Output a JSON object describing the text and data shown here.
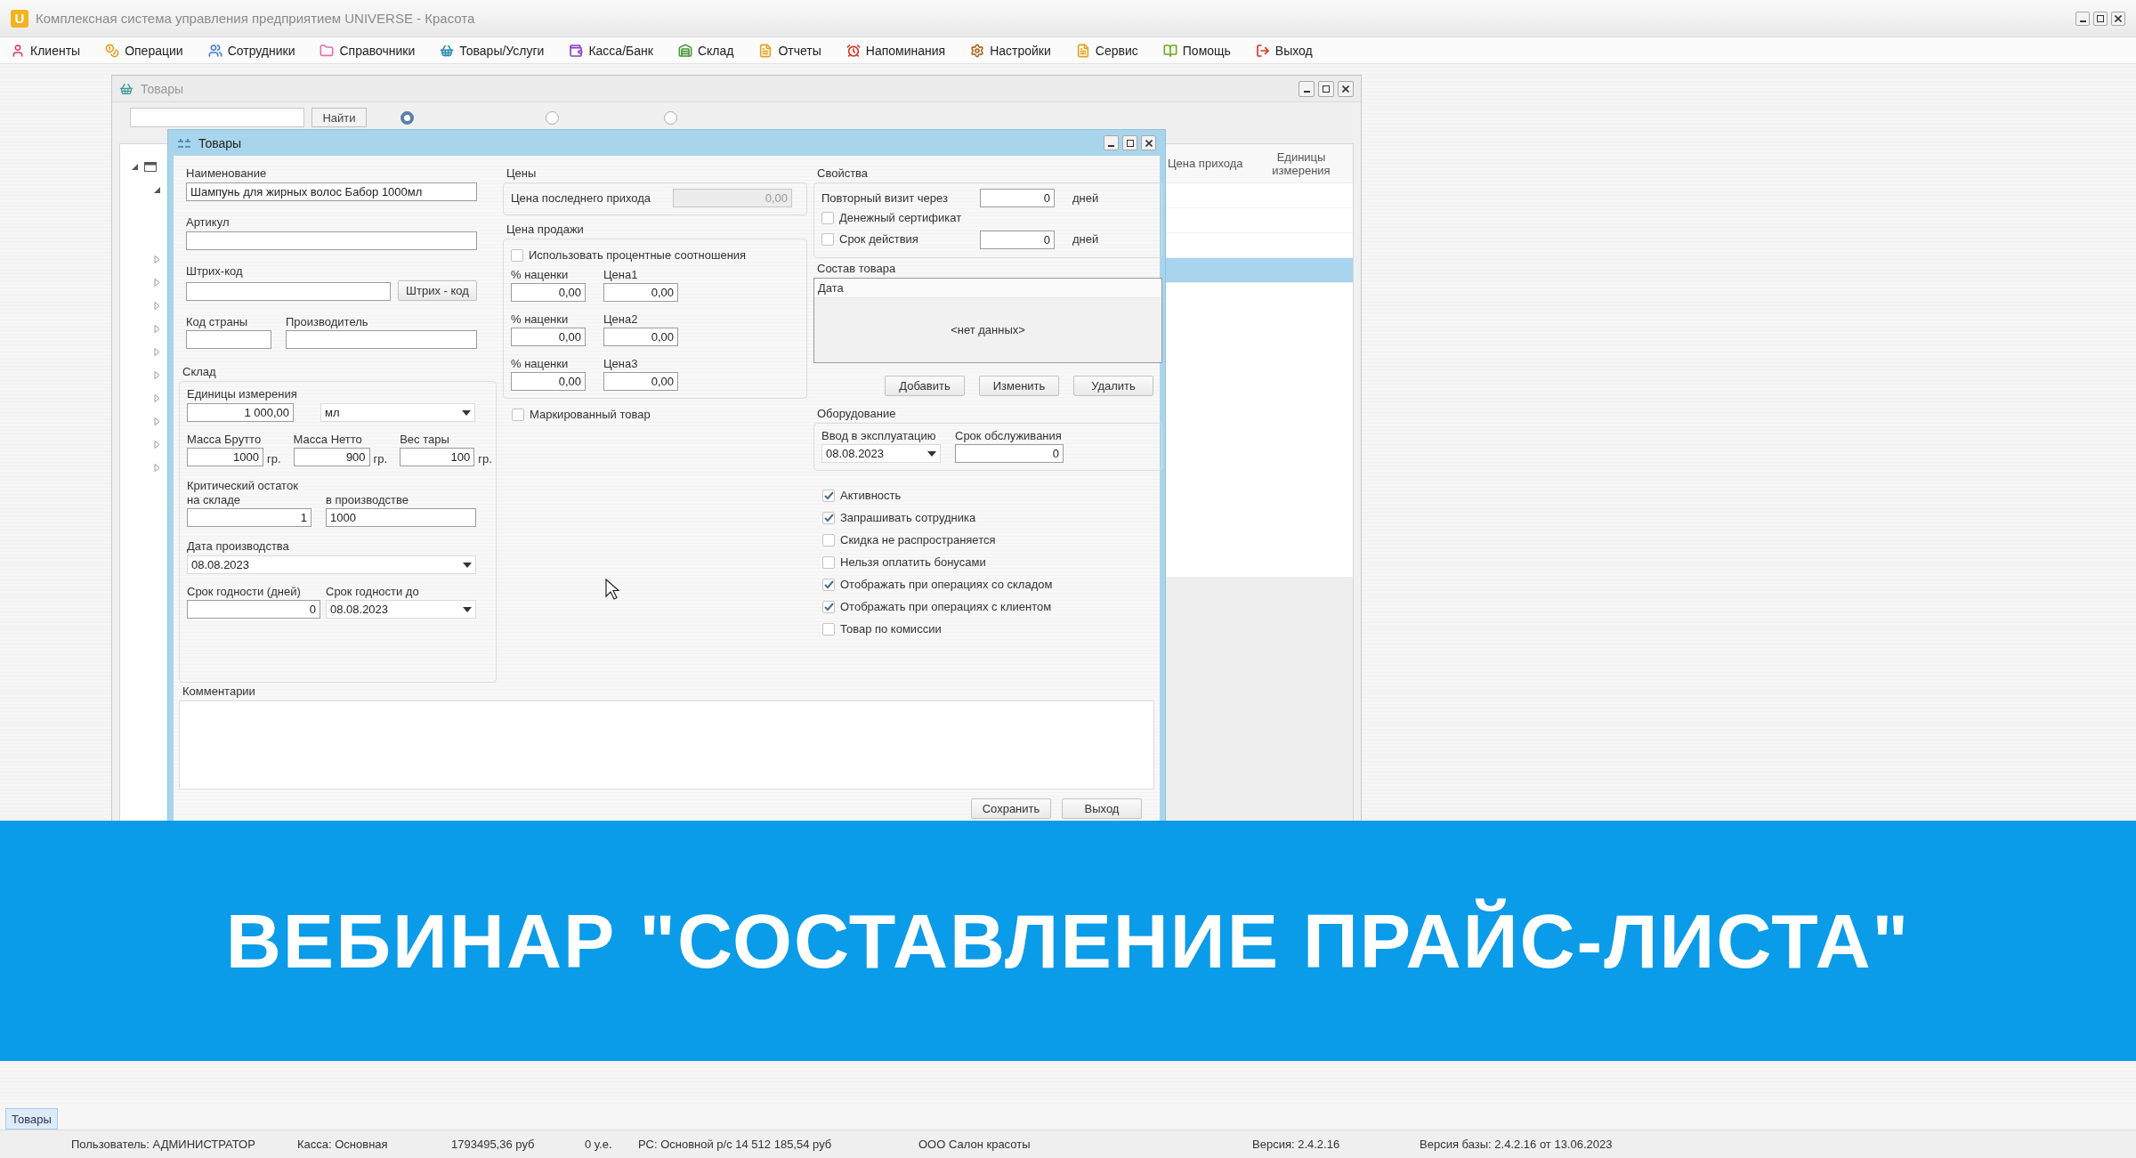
{
  "app_window": {
    "logo": "U",
    "title": "Комплексная система управления предприятием UNIVERSE - Красота"
  },
  "menu": [
    {
      "label": "Клиенты"
    },
    {
      "label": "Операции"
    },
    {
      "label": "Сотрудники"
    },
    {
      "label": "Справочники"
    },
    {
      "label": "Товары/Услуги"
    },
    {
      "label": "Касса/Банк"
    },
    {
      "label": "Склад"
    },
    {
      "label": "Отчеты"
    },
    {
      "label": "Напоминания"
    },
    {
      "label": "Настройки"
    },
    {
      "label": "Сервис"
    },
    {
      "label": "Помощь"
    },
    {
      "label": "Выход"
    }
  ],
  "list_window": {
    "title": "Товары",
    "search_button": "Найти",
    "modes": [
      {
        "selected": true
      },
      {
        "selected": false
      },
      {
        "selected": false
      }
    ],
    "tree": [
      {
        "expanded": true,
        "children": [
          {
            "expanded": true,
            "children": [
              {
                "expanded": false
              },
              {
                "expanded": false
              },
              {
                "expanded": false
              },
              {
                "expanded": false
              },
              {
                "expanded": false
              },
              {
                "expanded": false
              },
              {
                "expanded": false
              },
              {
                "expanded": false
              },
              {
                "expanded": false
              },
              {
                "expanded": false
              }
            ]
          }
        ]
      }
    ],
    "columns": [
      "Цена прихода",
      "Единицы измерения"
    ],
    "rows": [
      {
        "selected": false
      },
      {
        "selected": false
      },
      {
        "selected": false
      },
      {
        "selected": true
      }
    ]
  },
  "dialog": {
    "title": "Товары",
    "main": {
      "name_label": "Наименование",
      "name": "Шампунь для жирных волос Бабор 1000мл",
      "article_label": "Артикул",
      "barcode_label": "Штрих-код",
      "barcode_button": "Штрих - код",
      "country_label": "Код страны",
      "maker_label": "Производитель"
    },
    "warehouse": {
      "title": "Склад",
      "unit_label": "Единицы измерения",
      "unit_amount": "1 000,00",
      "unit": "мл",
      "weights": [
        {
          "label": "Масса Брутто",
          "value": "1000",
          "suffix": "гр."
        },
        {
          "label": "Масса Нетто",
          "value": "900",
          "suffix": "гр."
        },
        {
          "label": "Вес тары",
          "value": "100",
          "suffix": "гр."
        }
      ],
      "critical_label": "Критический остаток на складе",
      "production_label": "в производстве",
      "critical": "1",
      "production": "1000",
      "date_label": "Дата производства",
      "date": "08.08.2023",
      "shelf_days_label": "Срок годности (дней)",
      "shelf_days": "0",
      "shelf_until_label": "Срок годности до",
      "shelf_until": "08.08.2023"
    },
    "prices": {
      "title": "Цены",
      "last_label": "Цена последнего прихода",
      "last_value": "0,00",
      "last_disabled": true
    },
    "sale": {
      "title": "Цена продажи",
      "use_percent": {
        "label": "Использовать процентные соотношения",
        "checked": false
      },
      "levels": [
        {
          "markup_label": "% наценки",
          "markup": "0,00",
          "price_label": "Цена1",
          "price": "0,00"
        },
        {
          "markup_label": "% наценки",
          "markup": "0,00",
          "price_label": "Цена2",
          "price": "0,00"
        },
        {
          "markup_label": "% наценки",
          "markup": "0,00",
          "price_label": "Цена3",
          "price": "0,00"
        }
      ]
    },
    "marked": {
      "label": "Маркированный товар",
      "checked": false
    },
    "properties": {
      "title": "Свойства",
      "revisit_label": "Повторный визит через",
      "revisit": "0",
      "revisit_unit": "дней",
      "certificate": {
        "label": "Денежный сертификат",
        "checked": false
      },
      "validity": {
        "label": "Срок действия",
        "checked": false
      },
      "validity_value": "0",
      "validity_unit": "дней"
    },
    "composition": {
      "title": "Состав товара",
      "column": "Дата",
      "empty": "<нет данных>",
      "buttons": [
        "Добавить",
        "Изменить",
        "Удалить"
      ]
    },
    "equipment": {
      "title": "Оборудование",
      "commissioning_label": "Ввод в эксплуатацию",
      "commissioning": "08.08.2023",
      "service_label": "Срок обслуживания",
      "service": "0"
    },
    "flags": [
      {
        "label": "Активность",
        "checked": true
      },
      {
        "label": "Запрашивать сотрудника",
        "checked": true
      },
      {
        "label": "Скидка не распространяется",
        "checked": false
      },
      {
        "label": "Нельзя оплатить бонусами",
        "checked": false
      },
      {
        "label": "Отображать при операциях со складом",
        "checked": true
      },
      {
        "label": "Отображать при операциях с клиентом",
        "checked": true
      },
      {
        "label": "Товар по комиссии",
        "checked": false
      }
    ],
    "comments_label": "Комментарии",
    "buttons": [
      "Сохранить",
      "Выход"
    ]
  },
  "banner": "ВЕБИНАР \"СОСТАВЛЕНИЕ ПРАЙС-ЛИСТА\"",
  "window_tabs": [
    {
      "label": "Товары",
      "selected": true
    }
  ],
  "status_bar": [
    "Пользователь: АДМИНИСТРАТОР",
    "Касса: Основная",
    "1793495,36 руб",
    "0 у.е.",
    "РС: Основной р/с 14 512 185,54 руб",
    "ООО Салон красоты",
    "Версия: 2.4.2.16",
    "Версия базы: 2.4.2.16 от 13.06.2023"
  ]
}
